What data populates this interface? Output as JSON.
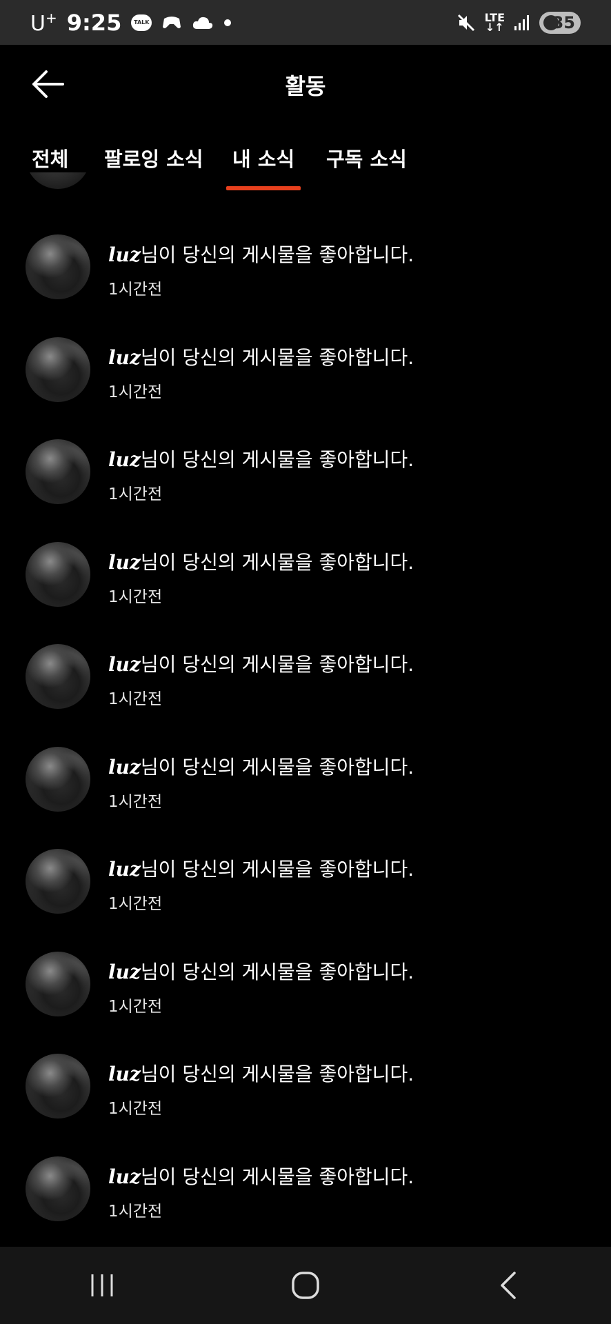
{
  "status_bar": {
    "carrier": "U",
    "carrier_sup": "+",
    "time": "9:25",
    "talk_label": "TALK",
    "network": "LTE",
    "battery": "35"
  },
  "header": {
    "title": "활동"
  },
  "tabs": [
    {
      "label": "전체",
      "active": false
    },
    {
      "label": "팔로잉 소식",
      "active": false
    },
    {
      "label": "내 소식",
      "active": true
    },
    {
      "label": "구독 소식",
      "active": false
    }
  ],
  "accent_color": "#e8401d",
  "notifications": [
    {
      "user": "luz",
      "message": "님이 당신의 게시물을 좋아합니다.",
      "time": "1시간전"
    },
    {
      "user": "luz",
      "message": "님이 당신의 게시물을 좋아합니다.",
      "time": "1시간전"
    },
    {
      "user": "luz",
      "message": "님이 당신의 게시물을 좋아합니다.",
      "time": "1시간전"
    },
    {
      "user": "luz",
      "message": "님이 당신의 게시물을 좋아합니다.",
      "time": "1시간전"
    },
    {
      "user": "luz",
      "message": "님이 당신의 게시물을 좋아합니다.",
      "time": "1시간전"
    },
    {
      "user": "luz",
      "message": "님이 당신의 게시물을 좋아합니다.",
      "time": "1시간전"
    },
    {
      "user": "luz",
      "message": "님이 당신의 게시물을 좋아합니다.",
      "time": "1시간전"
    },
    {
      "user": "luz",
      "message": "님이 당신의 게시물을 좋아합니다.",
      "time": "1시간전"
    },
    {
      "user": "luz",
      "message": "님이 당신의 게시물을 좋아합니다.",
      "time": "1시간전"
    },
    {
      "user": "luz",
      "message": "님이 당신의 게시물을 좋아합니다.",
      "time": "1시간전"
    }
  ],
  "nav_icons": [
    "recent-apps-icon",
    "home-icon",
    "back-icon"
  ]
}
